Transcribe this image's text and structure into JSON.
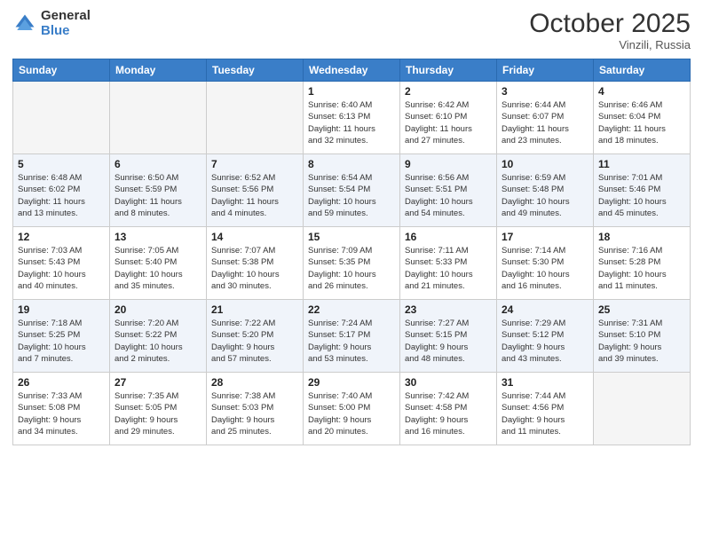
{
  "header": {
    "logo_general": "General",
    "logo_blue": "Blue",
    "month": "October 2025",
    "location": "Vinzili, Russia"
  },
  "weekdays": [
    "Sunday",
    "Monday",
    "Tuesday",
    "Wednesday",
    "Thursday",
    "Friday",
    "Saturday"
  ],
  "weeks": [
    [
      {
        "day": "",
        "info": ""
      },
      {
        "day": "",
        "info": ""
      },
      {
        "day": "",
        "info": ""
      },
      {
        "day": "1",
        "info": "Sunrise: 6:40 AM\nSunset: 6:13 PM\nDaylight: 11 hours\nand 32 minutes."
      },
      {
        "day": "2",
        "info": "Sunrise: 6:42 AM\nSunset: 6:10 PM\nDaylight: 11 hours\nand 27 minutes."
      },
      {
        "day": "3",
        "info": "Sunrise: 6:44 AM\nSunset: 6:07 PM\nDaylight: 11 hours\nand 23 minutes."
      },
      {
        "day": "4",
        "info": "Sunrise: 6:46 AM\nSunset: 6:04 PM\nDaylight: 11 hours\nand 18 minutes."
      }
    ],
    [
      {
        "day": "5",
        "info": "Sunrise: 6:48 AM\nSunset: 6:02 PM\nDaylight: 11 hours\nand 13 minutes."
      },
      {
        "day": "6",
        "info": "Sunrise: 6:50 AM\nSunset: 5:59 PM\nDaylight: 11 hours\nand 8 minutes."
      },
      {
        "day": "7",
        "info": "Sunrise: 6:52 AM\nSunset: 5:56 PM\nDaylight: 11 hours\nand 4 minutes."
      },
      {
        "day": "8",
        "info": "Sunrise: 6:54 AM\nSunset: 5:54 PM\nDaylight: 10 hours\nand 59 minutes."
      },
      {
        "day": "9",
        "info": "Sunrise: 6:56 AM\nSunset: 5:51 PM\nDaylight: 10 hours\nand 54 minutes."
      },
      {
        "day": "10",
        "info": "Sunrise: 6:59 AM\nSunset: 5:48 PM\nDaylight: 10 hours\nand 49 minutes."
      },
      {
        "day": "11",
        "info": "Sunrise: 7:01 AM\nSunset: 5:46 PM\nDaylight: 10 hours\nand 45 minutes."
      }
    ],
    [
      {
        "day": "12",
        "info": "Sunrise: 7:03 AM\nSunset: 5:43 PM\nDaylight: 10 hours\nand 40 minutes."
      },
      {
        "day": "13",
        "info": "Sunrise: 7:05 AM\nSunset: 5:40 PM\nDaylight: 10 hours\nand 35 minutes."
      },
      {
        "day": "14",
        "info": "Sunrise: 7:07 AM\nSunset: 5:38 PM\nDaylight: 10 hours\nand 30 minutes."
      },
      {
        "day": "15",
        "info": "Sunrise: 7:09 AM\nSunset: 5:35 PM\nDaylight: 10 hours\nand 26 minutes."
      },
      {
        "day": "16",
        "info": "Sunrise: 7:11 AM\nSunset: 5:33 PM\nDaylight: 10 hours\nand 21 minutes."
      },
      {
        "day": "17",
        "info": "Sunrise: 7:14 AM\nSunset: 5:30 PM\nDaylight: 10 hours\nand 16 minutes."
      },
      {
        "day": "18",
        "info": "Sunrise: 7:16 AM\nSunset: 5:28 PM\nDaylight: 10 hours\nand 11 minutes."
      }
    ],
    [
      {
        "day": "19",
        "info": "Sunrise: 7:18 AM\nSunset: 5:25 PM\nDaylight: 10 hours\nand 7 minutes."
      },
      {
        "day": "20",
        "info": "Sunrise: 7:20 AM\nSunset: 5:22 PM\nDaylight: 10 hours\nand 2 minutes."
      },
      {
        "day": "21",
        "info": "Sunrise: 7:22 AM\nSunset: 5:20 PM\nDaylight: 9 hours\nand 57 minutes."
      },
      {
        "day": "22",
        "info": "Sunrise: 7:24 AM\nSunset: 5:17 PM\nDaylight: 9 hours\nand 53 minutes."
      },
      {
        "day": "23",
        "info": "Sunrise: 7:27 AM\nSunset: 5:15 PM\nDaylight: 9 hours\nand 48 minutes."
      },
      {
        "day": "24",
        "info": "Sunrise: 7:29 AM\nSunset: 5:12 PM\nDaylight: 9 hours\nand 43 minutes."
      },
      {
        "day": "25",
        "info": "Sunrise: 7:31 AM\nSunset: 5:10 PM\nDaylight: 9 hours\nand 39 minutes."
      }
    ],
    [
      {
        "day": "26",
        "info": "Sunrise: 7:33 AM\nSunset: 5:08 PM\nDaylight: 9 hours\nand 34 minutes."
      },
      {
        "day": "27",
        "info": "Sunrise: 7:35 AM\nSunset: 5:05 PM\nDaylight: 9 hours\nand 29 minutes."
      },
      {
        "day": "28",
        "info": "Sunrise: 7:38 AM\nSunset: 5:03 PM\nDaylight: 9 hours\nand 25 minutes."
      },
      {
        "day": "29",
        "info": "Sunrise: 7:40 AM\nSunset: 5:00 PM\nDaylight: 9 hours\nand 20 minutes."
      },
      {
        "day": "30",
        "info": "Sunrise: 7:42 AM\nSunset: 4:58 PM\nDaylight: 9 hours\nand 16 minutes."
      },
      {
        "day": "31",
        "info": "Sunrise: 7:44 AM\nSunset: 4:56 PM\nDaylight: 9 hours\nand 11 minutes."
      },
      {
        "day": "",
        "info": ""
      }
    ]
  ]
}
